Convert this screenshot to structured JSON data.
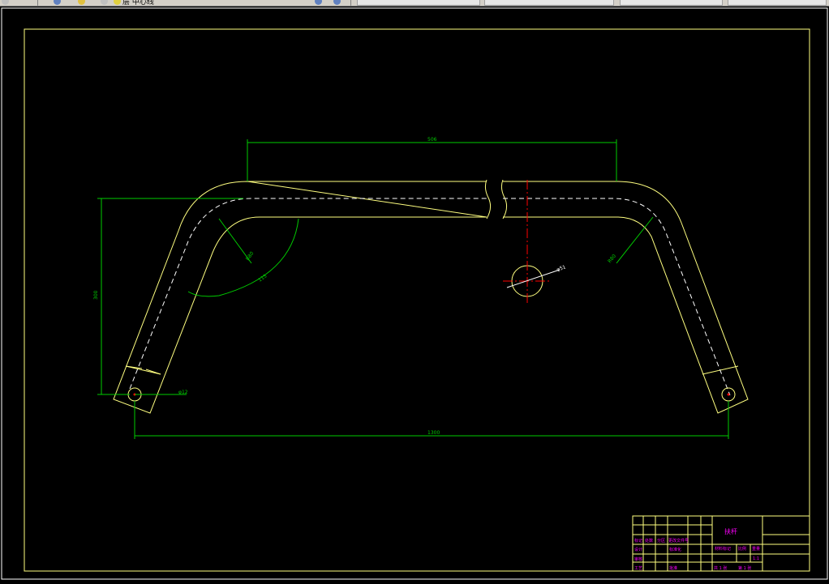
{
  "toolbar": {
    "layer_text": "层 中心线",
    "button_labels": [
      "",
      "",
      "",
      ""
    ]
  },
  "drawing": {
    "dims": {
      "top_width": "506",
      "overall_width": "1300",
      "height": "300",
      "bend_radius_left": "R80",
      "angle": "115",
      "bend_radius_right": "R80",
      "hole_dia": "φ12",
      "pipe_dia": "φ51"
    },
    "title_block": {
      "part_name": "扶杆",
      "material": "材料标记",
      "scale_label": "比例",
      "weight_label": "重量",
      "ratio": "1:1",
      "sheet_left": "共 1 张",
      "sheet_right": "第 1 张",
      "row_labels": [
        "标记",
        "处数",
        "分区",
        "更改文件号",
        "签名",
        "年月日"
      ],
      "designer": "设计",
      "standard": "标准化",
      "reviewer": "审核",
      "process": "工艺",
      "approve": "批准"
    }
  },
  "colors": {
    "outline": "#ffff80",
    "dimension": "#00cc00",
    "centerline": "#ff0000",
    "hidden": "#ffffff",
    "title_text": "#ff00ff",
    "background": "#000000"
  }
}
